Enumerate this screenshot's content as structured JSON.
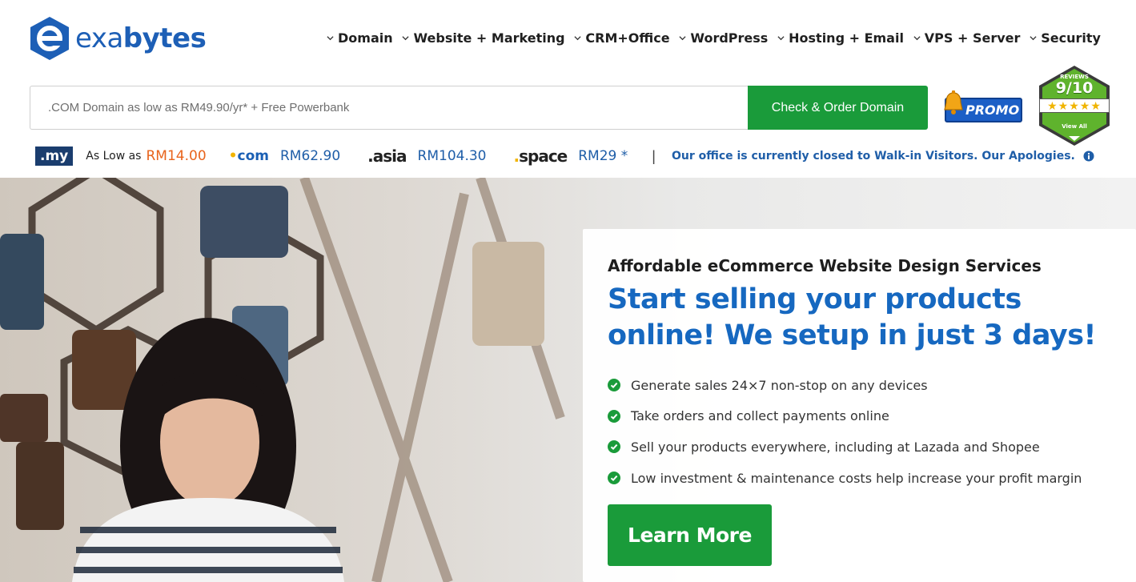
{
  "brand": {
    "logo_text_light": "exa",
    "logo_text_bold": "bytes"
  },
  "nav": {
    "items": [
      {
        "label": "Domain"
      },
      {
        "label": "Website + Marketing"
      },
      {
        "label": "CRM+Office"
      },
      {
        "label": "WordPress"
      },
      {
        "label": "Hosting + Email"
      },
      {
        "label": "VPS + Server"
      },
      {
        "label": "Security"
      }
    ]
  },
  "search": {
    "placeholder": ".COM Domain as low as RM49.90/yr* + Free Powerbank",
    "button_label": "Check & Order Domain"
  },
  "promo": {
    "label": "PROMO"
  },
  "reviews": {
    "top_label": "REVIEWS",
    "score": "9/10",
    "stars": "★★★★★",
    "view_label": "View All"
  },
  "domains": {
    "my_tld": ".my",
    "my_prefix": "As Low as",
    "my_price": "RM14.00",
    "com_tld": "com",
    "com_price": "RM62.90",
    "asia_tld": "asia",
    "asia_price": "RM104.30",
    "space_tld": "space",
    "space_price": "RM29 *",
    "separator": "|",
    "notice": "Our office is currently closed to Walk-in Visitors. Our Apologies."
  },
  "hero": {
    "subtitle": "Affordable eCommerce Website Design Services",
    "title": "Start selling your products online! We setup in just 3 days!",
    "features": [
      "Generate sales 24×7 non-stop on any devices",
      "Take orders and collect payments online",
      "Sell your products everywhere, including at Lazada and Shopee",
      "Low investment & maintenance costs help increase your profit margin"
    ],
    "cta_label": "Learn More"
  },
  "colors": {
    "brand_blue": "#1d5fb6",
    "cta_green": "#1a9b3a",
    "price_orange": "#e8641c",
    "title_blue": "#1668c0"
  }
}
